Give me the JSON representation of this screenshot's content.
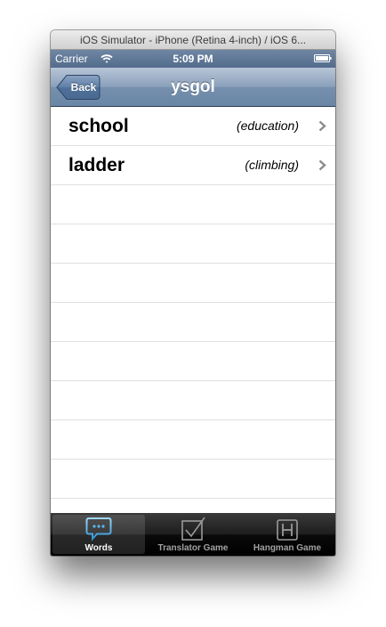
{
  "window": {
    "title": "iOS Simulator - iPhone (Retina 4-inch) / iOS 6..."
  },
  "status_bar": {
    "carrier": "Carrier",
    "time": "5:09 PM"
  },
  "nav_bar": {
    "back_label": "Back",
    "title": "ysgol"
  },
  "words": [
    {
      "word": "school",
      "category": "(education)"
    },
    {
      "word": "ladder",
      "category": "(climbing)"
    }
  ],
  "tabs": [
    {
      "label": "Words",
      "icon": "speech-bubble-icon",
      "selected": true
    },
    {
      "label": "Translator Game",
      "icon": "checkbox-icon",
      "selected": false
    },
    {
      "label": "Hangman Game",
      "icon": "letter-h-icon",
      "selected": false
    }
  ],
  "colors": {
    "nav_bar": "#7690ae",
    "status_bar": "#536c8c",
    "tab_bar": "#1d1d1d",
    "selected_tab_icon": "#5bb6ea"
  }
}
